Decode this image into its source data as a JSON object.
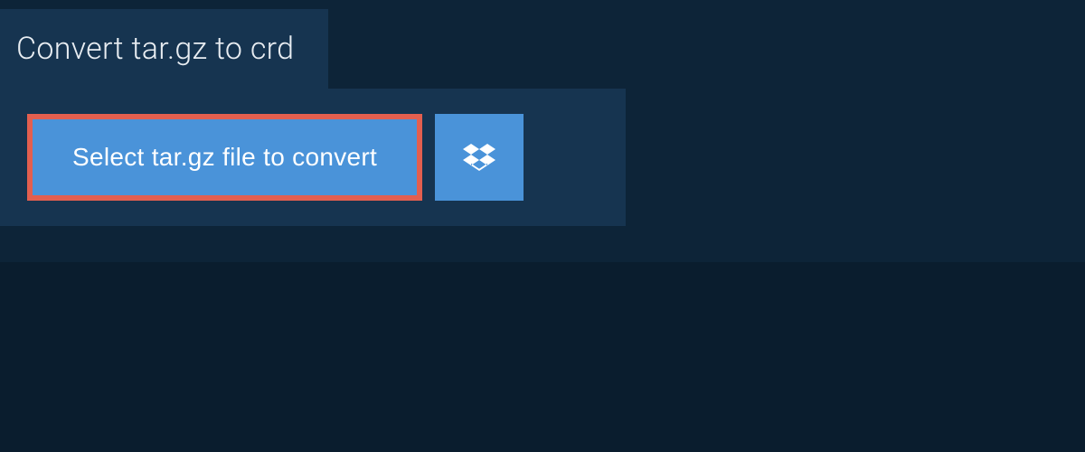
{
  "tab": {
    "title": "Convert tar.gz to crd"
  },
  "upload": {
    "select_label": "Select tar.gz file to convert"
  }
}
